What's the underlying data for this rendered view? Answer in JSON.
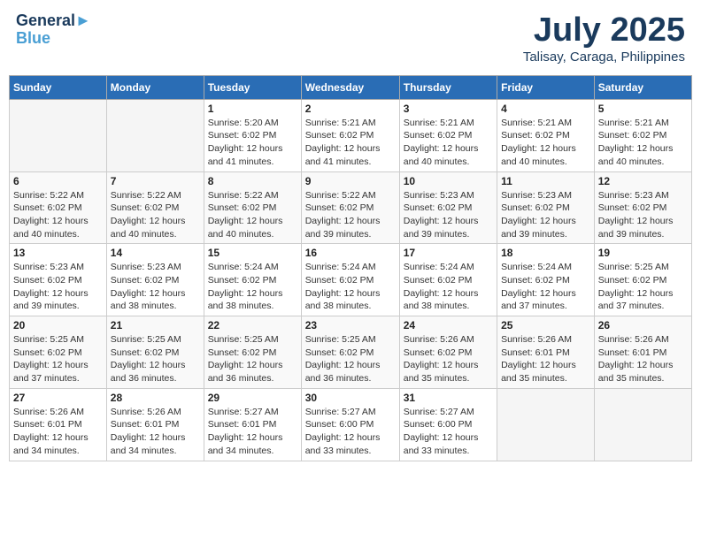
{
  "header": {
    "logo_line1": "General",
    "logo_line2": "Blue",
    "month": "July 2025",
    "location": "Talisay, Caraga, Philippines"
  },
  "weekdays": [
    "Sunday",
    "Monday",
    "Tuesday",
    "Wednesday",
    "Thursday",
    "Friday",
    "Saturday"
  ],
  "weeks": [
    [
      {
        "day": "",
        "empty": true
      },
      {
        "day": "",
        "empty": true
      },
      {
        "day": "1",
        "sunrise": "5:20 AM",
        "sunset": "6:02 PM",
        "daylight": "12 hours and 41 minutes."
      },
      {
        "day": "2",
        "sunrise": "5:21 AM",
        "sunset": "6:02 PM",
        "daylight": "12 hours and 41 minutes."
      },
      {
        "day": "3",
        "sunrise": "5:21 AM",
        "sunset": "6:02 PM",
        "daylight": "12 hours and 40 minutes."
      },
      {
        "day": "4",
        "sunrise": "5:21 AM",
        "sunset": "6:02 PM",
        "daylight": "12 hours and 40 minutes."
      },
      {
        "day": "5",
        "sunrise": "5:21 AM",
        "sunset": "6:02 PM",
        "daylight": "12 hours and 40 minutes."
      }
    ],
    [
      {
        "day": "6",
        "sunrise": "5:22 AM",
        "sunset": "6:02 PM",
        "daylight": "12 hours and 40 minutes."
      },
      {
        "day": "7",
        "sunrise": "5:22 AM",
        "sunset": "6:02 PM",
        "daylight": "12 hours and 40 minutes."
      },
      {
        "day": "8",
        "sunrise": "5:22 AM",
        "sunset": "6:02 PM",
        "daylight": "12 hours and 40 minutes."
      },
      {
        "day": "9",
        "sunrise": "5:22 AM",
        "sunset": "6:02 PM",
        "daylight": "12 hours and 39 minutes."
      },
      {
        "day": "10",
        "sunrise": "5:23 AM",
        "sunset": "6:02 PM",
        "daylight": "12 hours and 39 minutes."
      },
      {
        "day": "11",
        "sunrise": "5:23 AM",
        "sunset": "6:02 PM",
        "daylight": "12 hours and 39 minutes."
      },
      {
        "day": "12",
        "sunrise": "5:23 AM",
        "sunset": "6:02 PM",
        "daylight": "12 hours and 39 minutes."
      }
    ],
    [
      {
        "day": "13",
        "sunrise": "5:23 AM",
        "sunset": "6:02 PM",
        "daylight": "12 hours and 39 minutes."
      },
      {
        "day": "14",
        "sunrise": "5:23 AM",
        "sunset": "6:02 PM",
        "daylight": "12 hours and 38 minutes."
      },
      {
        "day": "15",
        "sunrise": "5:24 AM",
        "sunset": "6:02 PM",
        "daylight": "12 hours and 38 minutes."
      },
      {
        "day": "16",
        "sunrise": "5:24 AM",
        "sunset": "6:02 PM",
        "daylight": "12 hours and 38 minutes."
      },
      {
        "day": "17",
        "sunrise": "5:24 AM",
        "sunset": "6:02 PM",
        "daylight": "12 hours and 38 minutes."
      },
      {
        "day": "18",
        "sunrise": "5:24 AM",
        "sunset": "6:02 PM",
        "daylight": "12 hours and 37 minutes."
      },
      {
        "day": "19",
        "sunrise": "5:25 AM",
        "sunset": "6:02 PM",
        "daylight": "12 hours and 37 minutes."
      }
    ],
    [
      {
        "day": "20",
        "sunrise": "5:25 AM",
        "sunset": "6:02 PM",
        "daylight": "12 hours and 37 minutes."
      },
      {
        "day": "21",
        "sunrise": "5:25 AM",
        "sunset": "6:02 PM",
        "daylight": "12 hours and 36 minutes."
      },
      {
        "day": "22",
        "sunrise": "5:25 AM",
        "sunset": "6:02 PM",
        "daylight": "12 hours and 36 minutes."
      },
      {
        "day": "23",
        "sunrise": "5:25 AM",
        "sunset": "6:02 PM",
        "daylight": "12 hours and 36 minutes."
      },
      {
        "day": "24",
        "sunrise": "5:26 AM",
        "sunset": "6:02 PM",
        "daylight": "12 hours and 35 minutes."
      },
      {
        "day": "25",
        "sunrise": "5:26 AM",
        "sunset": "6:01 PM",
        "daylight": "12 hours and 35 minutes."
      },
      {
        "day": "26",
        "sunrise": "5:26 AM",
        "sunset": "6:01 PM",
        "daylight": "12 hours and 35 minutes."
      }
    ],
    [
      {
        "day": "27",
        "sunrise": "5:26 AM",
        "sunset": "6:01 PM",
        "daylight": "12 hours and 34 minutes."
      },
      {
        "day": "28",
        "sunrise": "5:26 AM",
        "sunset": "6:01 PM",
        "daylight": "12 hours and 34 minutes."
      },
      {
        "day": "29",
        "sunrise": "5:27 AM",
        "sunset": "6:01 PM",
        "daylight": "12 hours and 34 minutes."
      },
      {
        "day": "30",
        "sunrise": "5:27 AM",
        "sunset": "6:00 PM",
        "daylight": "12 hours and 33 minutes."
      },
      {
        "day": "31",
        "sunrise": "5:27 AM",
        "sunset": "6:00 PM",
        "daylight": "12 hours and 33 minutes."
      },
      {
        "day": "",
        "empty": true
      },
      {
        "day": "",
        "empty": true
      }
    ]
  ]
}
